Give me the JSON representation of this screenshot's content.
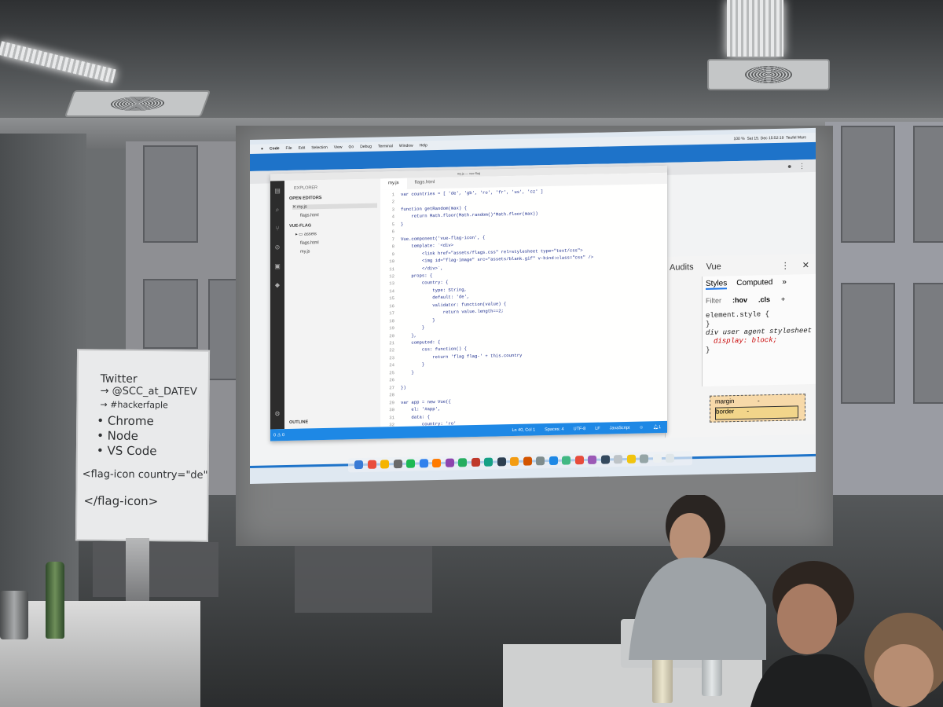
{
  "scene": {
    "menubar": {
      "app": "Code",
      "items": [
        "File",
        "Edit",
        "Selection",
        "View",
        "Go",
        "Debug",
        "Terminal",
        "Window",
        "Help"
      ],
      "battery": "100 %",
      "clock": "Sat 15. Dec 15:52:19",
      "user": "Teufel Marc"
    },
    "vscode": {
      "window_title": "my.js — vue-flag",
      "sidebar": {
        "header": "EXPLORER",
        "open_editors_label": "OPEN EDITORS",
        "open_editors": [
          "my.js",
          "flags.html"
        ],
        "project_label": "VUE-FLAG",
        "tree": [
          "assets",
          "flags.html",
          "my.js"
        ],
        "outline_label": "OUTLINE"
      },
      "tabs": [
        "my.js",
        "flags.html"
      ],
      "code_lines": [
        {
          "n": "1",
          "t": "var countries = [ 'de', 'gb', 'ro', 'fr', 'us', 'cz' ]"
        },
        {
          "n": "2",
          "t": ""
        },
        {
          "n": "3",
          "t": "function getRandom(max) {"
        },
        {
          "n": "4",
          "t": "    return Math.floor(Math.random()*Math.floor(max))"
        },
        {
          "n": "5",
          "t": "}"
        },
        {
          "n": "6",
          "t": ""
        },
        {
          "n": "7",
          "t": "Vue.component('vue-flag-icon', {"
        },
        {
          "n": "8",
          "t": "    template: `<div>"
        },
        {
          "n": "9",
          "t": "        <link href=\"assets/flags.css\" rel=stylesheet type=\"text/css\">"
        },
        {
          "n": "10",
          "t": "        <img id=\"flag-image\" src=\"assets/blank.gif\" v-bind:class=\"css\" />"
        },
        {
          "n": "11",
          "t": "        </div>`,"
        },
        {
          "n": "12",
          "t": "    props: {"
        },
        {
          "n": "13",
          "t": "        country: {"
        },
        {
          "n": "14",
          "t": "            type: String,"
        },
        {
          "n": "15",
          "t": "            default: 'de',"
        },
        {
          "n": "16",
          "t": "            validator: function(value) {"
        },
        {
          "n": "17",
          "t": "                return value.length==2;"
        },
        {
          "n": "18",
          "t": "            }"
        },
        {
          "n": "19",
          "t": "        }"
        },
        {
          "n": "20",
          "t": "    },"
        },
        {
          "n": "21",
          "t": "    computed: {"
        },
        {
          "n": "22",
          "t": "        css: function() {"
        },
        {
          "n": "23",
          "t": "            return 'flag flag-' + this.country"
        },
        {
          "n": "24",
          "t": "        }"
        },
        {
          "n": "25",
          "t": "    }"
        },
        {
          "n": "26",
          "t": ""
        },
        {
          "n": "27",
          "t": "})"
        },
        {
          "n": "28",
          "t": ""
        },
        {
          "n": "29",
          "t": "var app = new Vue({"
        },
        {
          "n": "30",
          "t": "    el: '#app',"
        },
        {
          "n": "31",
          "t": "    data: {"
        },
        {
          "n": "32",
          "t": "        country: 'ro'"
        }
      ],
      "status": {
        "problems": "0 ⚠ 0",
        "position": "Ln 40, Col 1",
        "spaces": "Spaces: 4",
        "encoding": "UTF-8",
        "eol": "LF",
        "language": "JavaScript",
        "notifications": "1"
      }
    },
    "devtools": {
      "tabs": [
        "Audits",
        "Vue"
      ],
      "styles_tabs": [
        "Styles",
        "Computed"
      ],
      "filter_label": "Filter",
      "hov_label": ":hov",
      "cls_label": ".cls",
      "rules": [
        "element.style {",
        "}",
        "div",
        "user agent stylesheet",
        "display: block;",
        "}"
      ],
      "box_model": {
        "margin": "margin",
        "border": "border",
        "dash": "-"
      }
    },
    "flipchart": {
      "lines": [
        "Twitter",
        "→ @SCC_at_DATEV",
        "→ #hackerfaple",
        "• Chrome",
        "• Node",
        "• VS Code",
        "<flag-icon country=\"de\"",
        "</flag-icon>"
      ]
    }
  }
}
